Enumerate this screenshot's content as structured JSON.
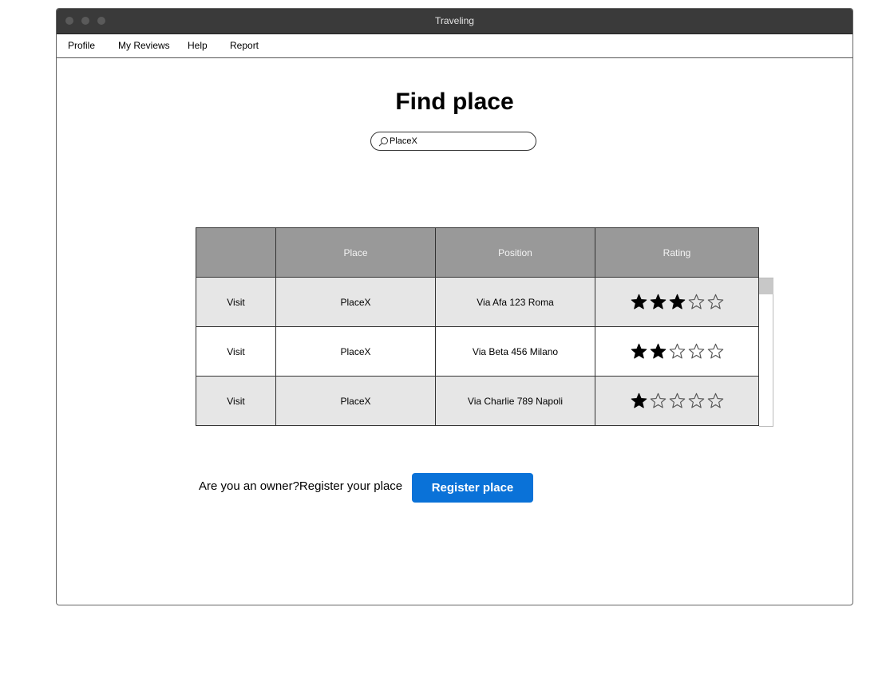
{
  "window": {
    "title": "Traveling"
  },
  "menu": [
    "Profile",
    "My Reviews",
    "Help",
    "Report"
  ],
  "page": {
    "heading": "Find place"
  },
  "search": {
    "value": "PlaceX",
    "icon": "search-icon"
  },
  "table": {
    "headers": [
      "",
      "Place",
      "Position",
      "Rating"
    ],
    "max_rating": 5,
    "rows": [
      {
        "action": "Visit",
        "place": "PlaceX",
        "position": "Via Afa 123 Roma",
        "rating": 3
      },
      {
        "action": "Visit",
        "place": "PlaceX",
        "position": "Via Beta 456 Milano",
        "rating": 2
      },
      {
        "action": "Visit",
        "place": "PlaceX",
        "position": "Via Charlie 789 Napoli",
        "rating": 1
      }
    ]
  },
  "footer": {
    "owner_prompt": "Are you an owner?Register your place",
    "register_label": "Register place"
  },
  "colors": {
    "titlebar": "#3a3a3a",
    "header_bg": "#999999",
    "row_shade": "#e6e6e6",
    "accent": "#0a72d8"
  }
}
